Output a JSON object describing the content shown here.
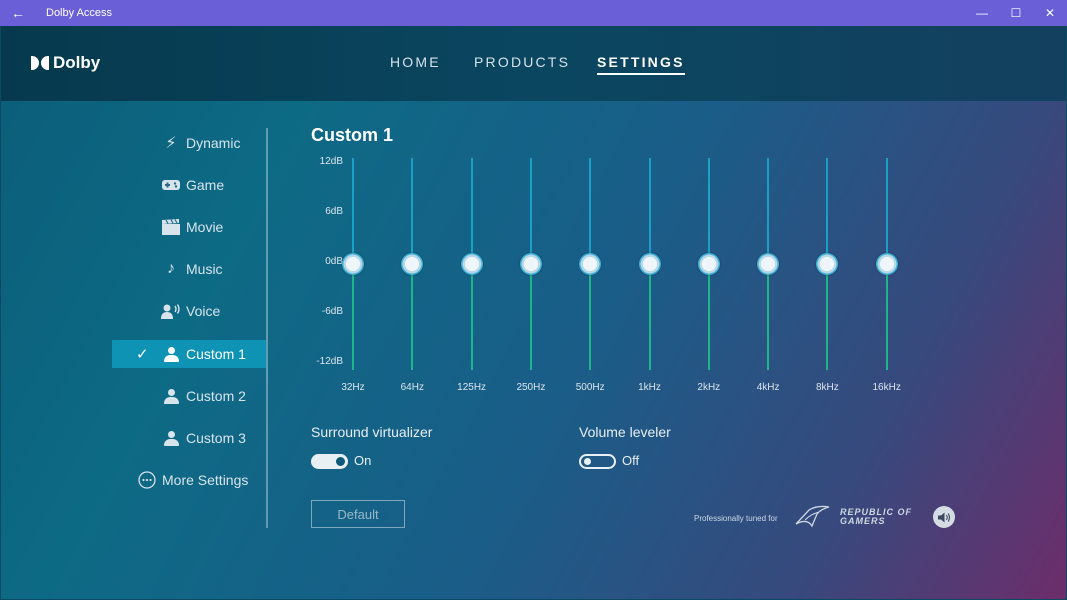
{
  "window": {
    "title": "Dolby Access"
  },
  "brand": {
    "name": "Dolby"
  },
  "nav": [
    {
      "label": "HOME"
    },
    {
      "label": "PRODUCTS"
    },
    {
      "label": "SETTINGS"
    }
  ],
  "sidebar": {
    "items": [
      {
        "label": "Dynamic",
        "icon": "lightning-icon"
      },
      {
        "label": "Game",
        "icon": "gamepad-icon"
      },
      {
        "label": "Movie",
        "icon": "clapperboard-icon"
      },
      {
        "label": "Music",
        "icon": "music-note-icon"
      },
      {
        "label": "Voice",
        "icon": "voice-icon"
      },
      {
        "label": "Custom 1",
        "icon": "person-icon",
        "selected": true
      },
      {
        "label": "Custom 2",
        "icon": "person-icon"
      },
      {
        "label": "Custom 3",
        "icon": "person-icon"
      }
    ],
    "more_settings": "More Settings"
  },
  "equalizer": {
    "title": "Custom 1",
    "db_labels": [
      "12dB",
      "6dB",
      "0dB",
      "-6dB",
      "-12dB"
    ],
    "db_range": [
      -12,
      12
    ],
    "bands": [
      {
        "freq": "32Hz",
        "gain_db": 0
      },
      {
        "freq": "64Hz",
        "gain_db": 0
      },
      {
        "freq": "125Hz",
        "gain_db": 0
      },
      {
        "freq": "250Hz",
        "gain_db": 0
      },
      {
        "freq": "500Hz",
        "gain_db": 0
      },
      {
        "freq": "1kHz",
        "gain_db": 0
      },
      {
        "freq": "2kHz",
        "gain_db": 0
      },
      {
        "freq": "4kHz",
        "gain_db": 0
      },
      {
        "freq": "8kHz",
        "gain_db": 0
      },
      {
        "freq": "16kHz",
        "gain_db": 0
      }
    ]
  },
  "surround": {
    "label": "Surround virtualizer",
    "state": "On",
    "on": true
  },
  "volume_leveler": {
    "label": "Volume leveler",
    "state": "Off",
    "on": false
  },
  "default_button": "Default",
  "tuned_for": "Professionally tuned for",
  "rog": {
    "line1": "REPUBLIC OF",
    "line2": "GAMERS"
  },
  "colors": {
    "accent": "#0f93b5",
    "titlebar": "#6a5fd6",
    "eq_upper": "#1aa0c4",
    "eq_lower": "#1fb58a"
  }
}
